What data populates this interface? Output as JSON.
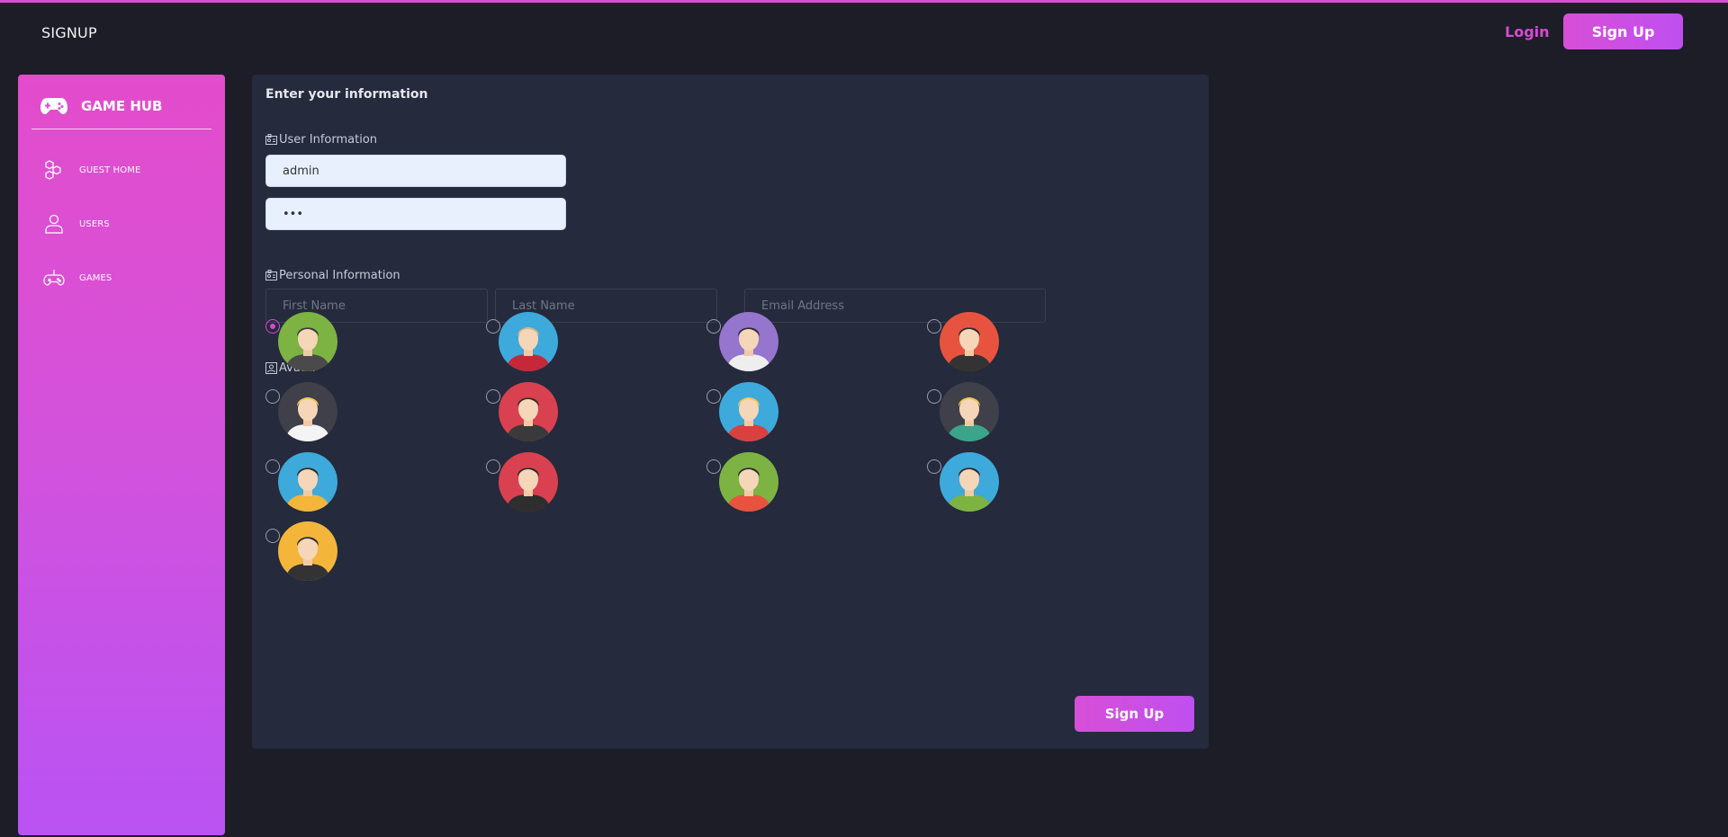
{
  "app": {
    "brand": "SIGNUP",
    "login_label": "Login",
    "signup_label": "Sign Up"
  },
  "sidebar": {
    "brand": "GAME HUB",
    "items": [
      {
        "label": "GUEST HOME",
        "icon": "hexagons-icon"
      },
      {
        "label": "USERS",
        "icon": "user-icon"
      },
      {
        "label": "GAMES",
        "icon": "gamepad-icon"
      }
    ]
  },
  "form": {
    "title": "Enter your information",
    "user_section": "User Information",
    "username_value": "admin",
    "password_value": "•••",
    "personal_section": "Personal Information",
    "first_name_placeholder": "First Name",
    "last_name_placeholder": "Last Name",
    "email_placeholder": "Email Address",
    "avatar_section": "Avatar",
    "selected_avatar": 1,
    "avatars": [
      {
        "bg": "#7cb342",
        "hair": "#3a3a3a",
        "shirt": "#4a4a4a"
      },
      {
        "bg": "#3ea9db",
        "hair": "#d6b48a",
        "shirt": "#c6283a"
      },
      {
        "bg": "#9575cd",
        "hair": "#2b2b35",
        "shirt": "#eeeeee"
      },
      {
        "bg": "#e8533f",
        "hair": "#2b2b2b",
        "shirt": "#333333"
      },
      {
        "bg": "#3f4049",
        "hair": "#f3c74e",
        "shirt": "#f4f4f4"
      },
      {
        "bg": "#d94050",
        "hair": "#3a2a20",
        "shirt": "#3a3a3a"
      },
      {
        "bg": "#3ea9db",
        "hair": "#f3c74e",
        "shirt": "#d94040"
      },
      {
        "bg": "#3f4049",
        "hair": "#f3c74e",
        "shirt": "#3aa58a"
      },
      {
        "bg": "#3ea9db",
        "hair": "#2b2b2b",
        "shirt": "#f3b63a"
      },
      {
        "bg": "#d94050",
        "hair": "#2b2b2b",
        "shirt": "#2e2e2e"
      },
      {
        "bg": "#7cb342",
        "hair": "#2b2b2b",
        "shirt": "#e8533f"
      },
      {
        "bg": "#3ea9db",
        "hair": "#2b2b2b",
        "shirt": "#7cb342"
      },
      {
        "bg": "#f3b63a",
        "hair": "#2b2b2b",
        "shirt": "#333333"
      }
    ],
    "submit_label": "Sign Up"
  },
  "colors": {
    "accent": "#d64ad3",
    "background": "#1d1d27",
    "panel": "#252a3c"
  }
}
